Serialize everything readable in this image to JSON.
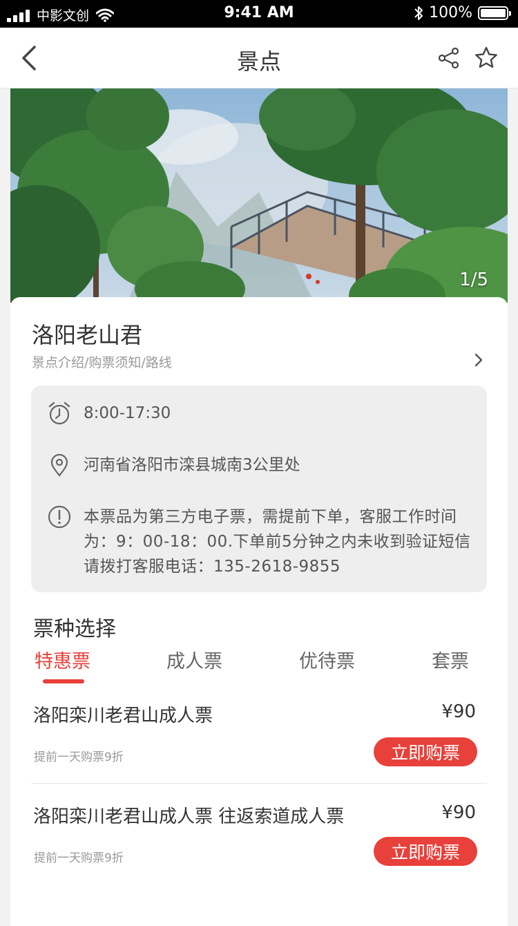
{
  "status_bar": {
    "carrier": "中影文创",
    "time": "9:41 AM",
    "battery": "100%",
    "battery_level": 1.0
  },
  "nav": {
    "title": "景点",
    "back_icon": "chevron-left-icon",
    "share_icon": "share-icon",
    "favorite_icon": "star-outline-icon"
  },
  "hero": {
    "counter": "1/5"
  },
  "spot": {
    "name": "洛阳老山君",
    "links": "景点介绍/购票须知/路线"
  },
  "info": {
    "hours": "8:00-17:30",
    "address": "河南省洛阳市滦县城南3公里处",
    "notice": "本票品为第三方电子票，需提前下单，客服工作时间为：9：00-18：00.下单前5分钟之内未收到验证短信请拨打客服电话：135-2618-9855"
  },
  "ticket_section": {
    "title": "票种选择",
    "tabs": [
      {
        "label": "特惠票",
        "active": true
      },
      {
        "label": "成人票",
        "active": false
      },
      {
        "label": "优待票",
        "active": false
      },
      {
        "label": "套票",
        "active": false
      }
    ]
  },
  "tickets": [
    {
      "name": "洛阳栾川老君山成人票",
      "price": "¥90",
      "note": "提前一天购票9折",
      "button": "立即购票"
    },
    {
      "name": "洛阳栾川老君山成人票 往返索道成人票",
      "price": "¥90",
      "note": "提前一天购票9折",
      "button": "立即购票"
    }
  ],
  "colors": {
    "accent": "#e8403a",
    "text": "#333333",
    "muted": "#999999",
    "info_bg": "#eeeeee"
  }
}
